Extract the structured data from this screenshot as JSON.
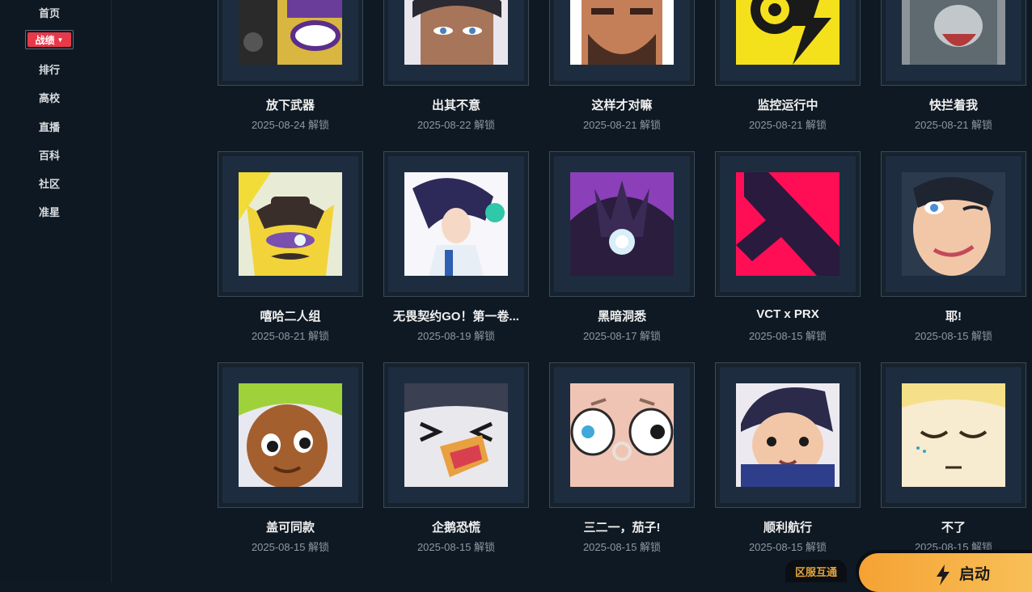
{
  "sidebar": {
    "items": [
      "首页",
      "战绩",
      "排行",
      "高校",
      "直播",
      "百科",
      "社区",
      "准星"
    ],
    "active_label": "战绩"
  },
  "rows": [
    [
      {
        "title": "放下武器",
        "date": "2025-08-24 解锁",
        "icon": "robot-yellow-spray-icon"
      },
      {
        "title": "出其不意",
        "date": "2025-08-22 解锁",
        "icon": "agent-portrait-spray-icon"
      },
      {
        "title": "这样才对嘛",
        "date": "2025-08-21 解锁",
        "icon": "bearded-man-spray-icon"
      },
      {
        "title": "监控运行中",
        "date": "2025-08-21 解锁",
        "icon": "camera-yellow-spray-icon"
      },
      {
        "title": "快拦着我",
        "date": "2025-08-21 解锁",
        "icon": "badger-spray-icon"
      }
    ],
    [
      {
        "title": "嘻哈二人组",
        "date": "2025-08-21 解锁",
        "icon": "cowboy-bird-spray-icon"
      },
      {
        "title": "无畏契约GO！第一卷...",
        "date": "2025-08-19 解锁",
        "icon": "anime-girl-spray-icon"
      },
      {
        "title": "黑暗洞悉",
        "date": "2025-08-17 解锁",
        "icon": "dark-creature-spray-icon"
      },
      {
        "title": "VCT x PRX",
        "date": "2025-08-15 解锁",
        "icon": "prx-logo-spray-icon"
      },
      {
        "title": "耶!",
        "date": "2025-08-15 解锁",
        "icon": "winking-woman-spray-icon"
      }
    ],
    [
      {
        "title": "盖可同款",
        "date": "2025-08-15 解锁",
        "icon": "green-hair-kid-spray-icon"
      },
      {
        "title": "企鹅恐慌",
        "date": "2025-08-15 解锁",
        "icon": "penguin-spray-icon"
      },
      {
        "title": "三二一，茄子!",
        "date": "2025-08-15 解锁",
        "icon": "wide-eyed-face-spray-icon"
      },
      {
        "title": "顺利航行",
        "date": "2025-08-15 解锁",
        "icon": "pilot-boy-spray-icon"
      },
      {
        "title": "不了",
        "date": "2025-08-15 解锁",
        "icon": "sleepy-blonde-spray-icon"
      }
    ]
  ],
  "footer": {
    "region_label": "区服互通",
    "launch_label": "启动"
  },
  "colors": {
    "background": "#0f1923",
    "active_nav": "#e8394a",
    "launch_gradient_start": "#f5a233",
    "launch_gradient_end": "#f8c15a",
    "region_text": "#e3a53b"
  }
}
